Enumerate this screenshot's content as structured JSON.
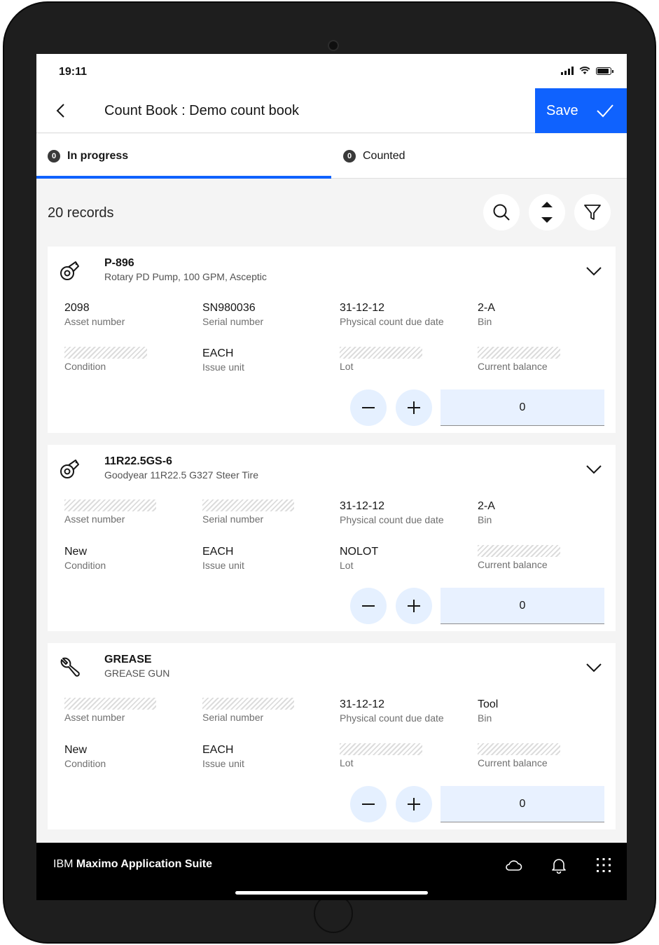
{
  "status_bar": {
    "time": "19:11"
  },
  "header": {
    "title": "Count Book : Demo count book",
    "save_label": "Save"
  },
  "tabs": [
    {
      "label": "In progress",
      "badge": "0"
    },
    {
      "label": "Counted",
      "badge": "0"
    }
  ],
  "records_label": "20 records",
  "field_labels": {
    "asset_number": "Asset number",
    "serial_number": "Serial number",
    "due_date": "Physical count due date",
    "bin": "Bin",
    "condition": "Condition",
    "issue_unit": "Issue unit",
    "lot": "Lot",
    "current_balance": "Current balance"
  },
  "cards": [
    {
      "icon": "pump-icon",
      "item_num": "P-896",
      "description": "Rotary PD Pump, 100 GPM, Asceptic",
      "asset_number": "2098",
      "serial_number": "SN980036",
      "due_date": "31-12-12",
      "bin": "2-A",
      "condition": "",
      "issue_unit": "EACH",
      "lot": "",
      "current_balance": "",
      "count": "0"
    },
    {
      "icon": "pump-icon",
      "item_num": "11R22.5GS-6",
      "description": "Goodyear 11R22.5 G327 Steer Tire",
      "asset_number": "",
      "serial_number": "",
      "due_date": "31-12-12",
      "bin": "2-A",
      "condition": "New",
      "issue_unit": "EACH",
      "lot": "NOLOT",
      "current_balance": "",
      "count": "0"
    },
    {
      "icon": "wrench-icon",
      "item_num": "GREASE",
      "description": "GREASE GUN",
      "asset_number": "",
      "serial_number": "",
      "due_date": "31-12-12",
      "bin": "Tool",
      "condition": "New",
      "issue_unit": "EACH",
      "lot": "",
      "current_balance": "",
      "count": "0"
    }
  ],
  "footer": {
    "brand_prefix": "IBM",
    "brand_name": "Maximo Application Suite"
  },
  "colors": {
    "accent": "#0f62fe",
    "stepper_bg": "#e5f0ff",
    "footer_bg": "#000000"
  }
}
